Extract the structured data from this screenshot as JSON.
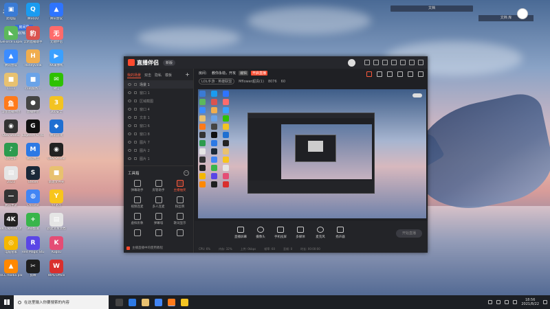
{
  "watermark": {
    "logo_text": "斗鱼",
    "badge": "房间号",
    "room": "8076"
  },
  "top_right": {
    "label1": "文档",
    "label2": "文档 库"
  },
  "desktop_icons": [
    {
      "label": "此电脑",
      "color": "#3a7bd5",
      "glyph": "▣"
    },
    {
      "label": "腾讯QQ",
      "color": "#1a9bf0",
      "glyph": "Q"
    },
    {
      "label": "腾讯会议",
      "color": "#2e74ff",
      "glyph": "▲"
    },
    {
      "label": "GeForce Experience",
      "color": "#5cb85c",
      "glyph": "◣"
    },
    {
      "label": "云豹直播助手",
      "color": "#d9534f",
      "glyph": "豹"
    },
    {
      "label": "无他伴侣",
      "color": "#ff6b6b",
      "glyph": "无"
    },
    {
      "label": "腾讯会议",
      "color": "#3b8cff",
      "glyph": "▲"
    },
    {
      "label": "Honeyview",
      "color": "#f0ad4e",
      "glyph": "H"
    },
    {
      "label": "KK录像机",
      "color": "#3aa0ff",
      "glyph": "▶"
    },
    {
      "label": "1111",
      "color": "#e8c170",
      "glyph": "■"
    },
    {
      "label": "c1的服务...",
      "color": "#6aa3e8",
      "glyph": "■"
    },
    {
      "label": "微信",
      "color": "#2dc100",
      "glyph": "✉"
    },
    {
      "label": "斗鱼直播伴侣",
      "color": "#ff7a1a",
      "glyph": "鱼"
    },
    {
      "label": "直播伴侣",
      "color": "#444",
      "glyph": "●"
    },
    {
      "label": "360安全",
      "color": "#f3c322",
      "glyph": "3"
    },
    {
      "label": "OBS Studio",
      "color": "#333",
      "glyph": "◉"
    },
    {
      "label": "Logitech G HUB",
      "color": "#111",
      "glyph": "G"
    },
    {
      "label": "腾讯游戏",
      "color": "#1f6fd1",
      "glyph": "◆"
    },
    {
      "label": "QQ音乐",
      "color": "#2c9b4e",
      "glyph": "♪"
    },
    {
      "label": "微软拼音",
      "color": "#2d79e4",
      "glyph": "M"
    },
    {
      "label": "OBS Studio",
      "color": "#222",
      "glyph": "◉"
    },
    {
      "label": "2021",
      "color": "#e5e5e5",
      "glyph": "▤"
    },
    {
      "label": "Steam",
      "color": "#1b2838",
      "glyph": "S"
    },
    {
      "label": "新建文件夹",
      "color": "#e8c170",
      "glyph": "■"
    },
    {
      "label": "腾讯手游",
      "color": "#333",
      "glyph": "—"
    },
    {
      "label": "Chrome",
      "color": "#4285f4",
      "glyph": "◍"
    },
    {
      "label": "YY语音",
      "color": "#f8c51c",
      "glyph": "Y"
    },
    {
      "label": "4K Capture Utility",
      "color": "#222",
      "glyph": "4K"
    },
    {
      "label": "360加速",
      "color": "#39b54a",
      "glyph": "+"
    },
    {
      "label": "新建文本文档",
      "color": "#e5e5e5",
      "glyph": "▤"
    },
    {
      "label": "电脑管家",
      "color": "#f5b700",
      "glyph": "◎"
    },
    {
      "label": "Red Magic Studio",
      "color": "#5a46e6",
      "glyph": "R"
    },
    {
      "label": "Kugou",
      "color": "#e44d75",
      "glyph": "K"
    },
    {
      "label": "VLC media player",
      "color": "#ff8800",
      "glyph": "▲"
    },
    {
      "label": "剪映",
      "color": "#1f1f1f",
      "glyph": "✂"
    },
    {
      "label": "WPS Office",
      "color": "#d9302e",
      "glyph": "W"
    }
  ],
  "app": {
    "name": "直播伴侣",
    "version": "新版",
    "side_tabs": [
      "我的场景",
      "双击",
      "隐私",
      "模板"
    ],
    "scenes": [
      "场景 1",
      "窗口 1",
      "区域截图",
      "窗口 4",
      "文本 1",
      "窗口 6",
      "窗口 8",
      "图片 7",
      "图片 2",
      "图片 1"
    ],
    "tools_title": "工具箱",
    "tools": [
      {
        "label": "弹幕助手",
        "red": false
      },
      {
        "label": "房管助手",
        "red": false
      },
      {
        "label": "主播抽奖",
        "red": true
      },
      {
        "label": "视频连麦",
        "red": false
      },
      {
        "label": "多人连麦",
        "red": false
      },
      {
        "label": "粉丝牌",
        "red": false
      },
      {
        "label": "虚拟形象",
        "red": false
      },
      {
        "label": "弹幕墙",
        "red": false
      },
      {
        "label": "歌词显示",
        "red": false
      },
      {
        "label": "",
        "red": false
      },
      {
        "label": "",
        "red": false
      },
      {
        "label": "",
        "red": false
      }
    ],
    "side_footer": "主播直播中的使用教程",
    "stream": {
      "title_label": "房间：",
      "title": "教你永劫，开攻",
      "tag1": "编辑",
      "tag2": "开启直播",
      "category": "LOL手游 · 英雄联盟",
      "resolution": "Mflower超清(1)",
      "bitrate": "8076",
      "fps": "60"
    },
    "bottom_tools": [
      "直播屏幕",
      "摄像头",
      "手机投屏",
      "多媒体",
      "麦克风",
      "扬声器"
    ],
    "start_label": "开始直播",
    "status": [
      "CPU: 6%",
      "内存: 32%",
      "上传: 0kbps",
      "帧率: 60",
      "丢帧: 0",
      "时长: 00:00:00"
    ]
  },
  "taskbar": {
    "search_placeholder": "在这里输入你要搜索的内容",
    "apps_colors": [
      "#444",
      "#2d79e4",
      "#e8c170",
      "#4285f4",
      "#ff7a1a",
      "#f3c322"
    ],
    "time": "18:56",
    "date": "2021/8/22"
  }
}
